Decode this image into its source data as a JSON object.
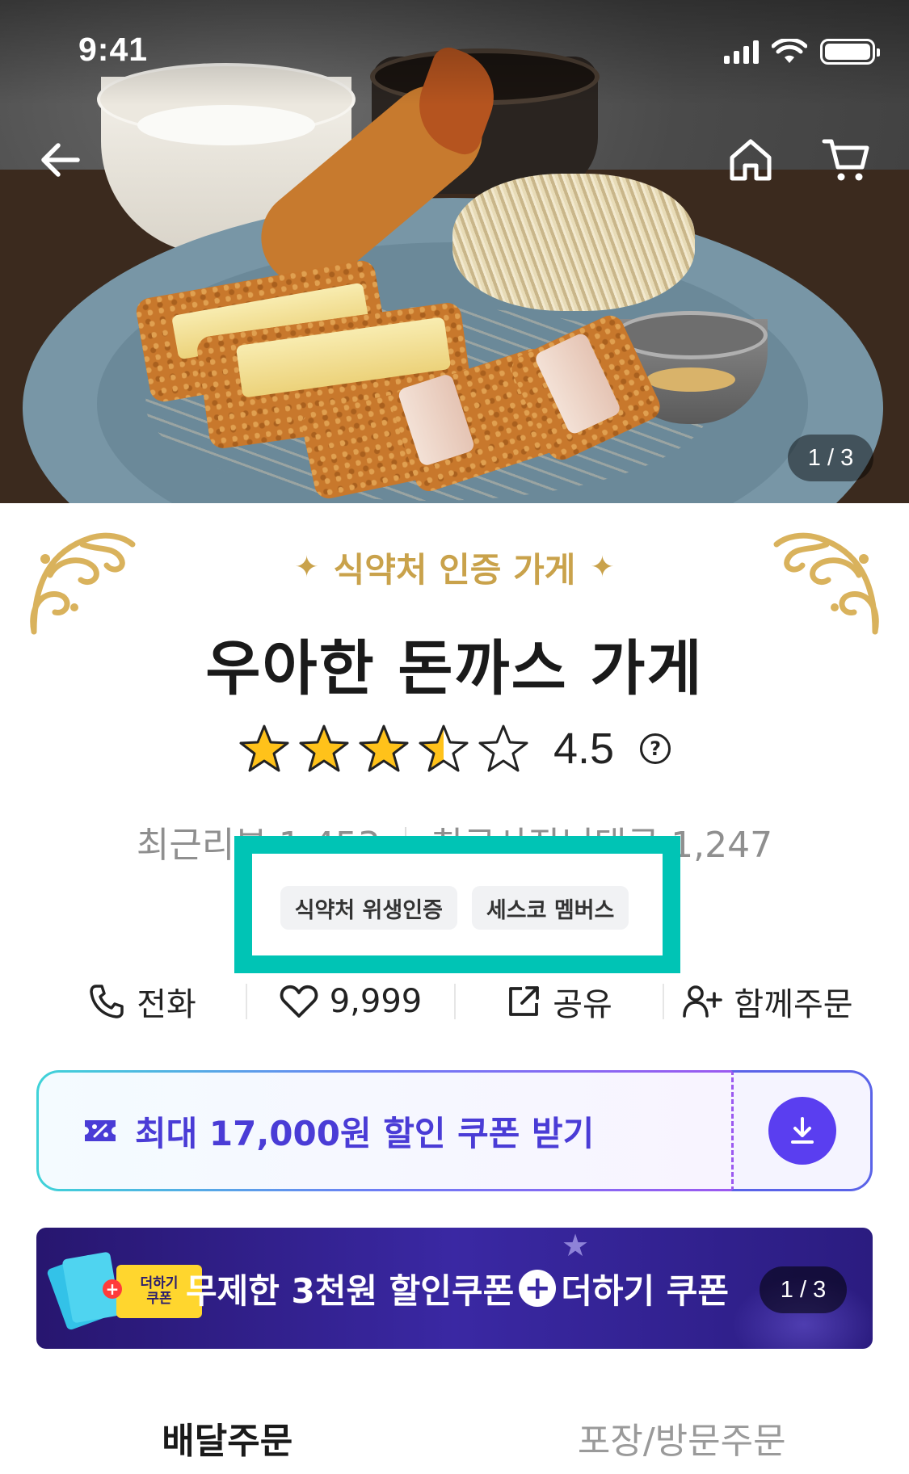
{
  "status_bar": {
    "time": "9:41"
  },
  "hero": {
    "image_counter": "1 / 3"
  },
  "nav": {
    "back_icon": "arrow-left-icon",
    "home_icon": "home-icon",
    "cart_icon": "cart-icon"
  },
  "store": {
    "certification_title": "식약처 인증 가게",
    "name": "우아한 돈까스 가게",
    "rating": "4.5",
    "stars": 4.5,
    "recent_reviews_label": "최근리뷰",
    "recent_reviews_count": "1,453",
    "owner_replies_label": "최근사장님댓글",
    "owner_replies_count": "1,247"
  },
  "tags": [
    "식약처 위생인증",
    "세스코 멤버스"
  ],
  "actions": [
    {
      "icon": "phone-icon",
      "label": "전화"
    },
    {
      "icon": "heart-icon",
      "label": "9,999"
    },
    {
      "icon": "share-icon",
      "label": "공유"
    },
    {
      "icon": "add-person-icon",
      "label": "함께주문"
    }
  ],
  "coupon": {
    "text": "최대 17,000원 할인 쿠폰 받기",
    "icon": "percent-coupon-icon",
    "download_icon": "download-icon"
  },
  "banner": {
    "ticket_label_top": "더하기",
    "ticket_label_bottom": "쿠폰",
    "ticket_small": "쿠폰",
    "text_part1": "무제한 3천원 할인쿠폰",
    "text_part2": "더하기 쿠폰",
    "pager": "1 / 3"
  },
  "tabs": [
    {
      "label": "배달주문",
      "active": true
    },
    {
      "label": "포장/방문주문",
      "active": false
    }
  ],
  "colors": {
    "highlight": "#00c4b5",
    "gold": "#c9a24b",
    "coupon_text": "#4a3cd6",
    "banner_bg": "#3a28a3"
  }
}
